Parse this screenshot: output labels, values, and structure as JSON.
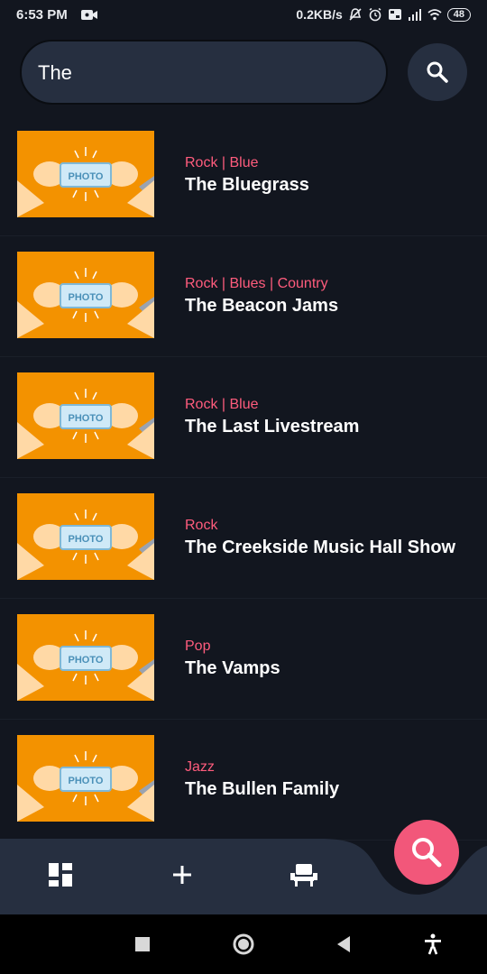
{
  "status_bar": {
    "time": "6:53 PM",
    "network_speed": "0.2KB/s",
    "battery": "48",
    "icons": [
      "camera-icon",
      "alarm-off-icon",
      "alarm-icon",
      "volte-icon",
      "signal-icon",
      "wifi-icon",
      "battery-icon"
    ]
  },
  "search": {
    "value": "The",
    "button_icon": "search-icon"
  },
  "results": [
    {
      "genre": "Rock | Blue",
      "title": "The Bluegrass",
      "thumbnail_label": "PHOTO"
    },
    {
      "genre": "Rock | Blues | Country",
      "title": "The Beacon Jams",
      "thumbnail_label": "PHOTO"
    },
    {
      "genre": "Rock | Blue",
      "title": "The Last Livestream",
      "thumbnail_label": "PHOTO"
    },
    {
      "genre": "Rock",
      "title": "The Creekside Music Hall Show",
      "thumbnail_label": "PHOTO"
    },
    {
      "genre": "Pop",
      "title": "The Vamps",
      "thumbnail_label": "PHOTO"
    },
    {
      "genre": "Jazz",
      "title": "The Bullen Family",
      "thumbnail_label": "PHOTO"
    }
  ],
  "bottom_nav": {
    "items": [
      "dashboard-icon",
      "add-icon",
      "seat-icon"
    ],
    "fab_icon": "search-icon"
  },
  "system_nav": [
    "recents-icon",
    "home-icon",
    "back-icon",
    "accessibility-icon"
  ],
  "colors": {
    "background": "#12161f",
    "surface": "#262f40",
    "accent": "#f2577a",
    "genre_text": "#ff5c7d",
    "thumbnail_bg": "#f39200"
  }
}
